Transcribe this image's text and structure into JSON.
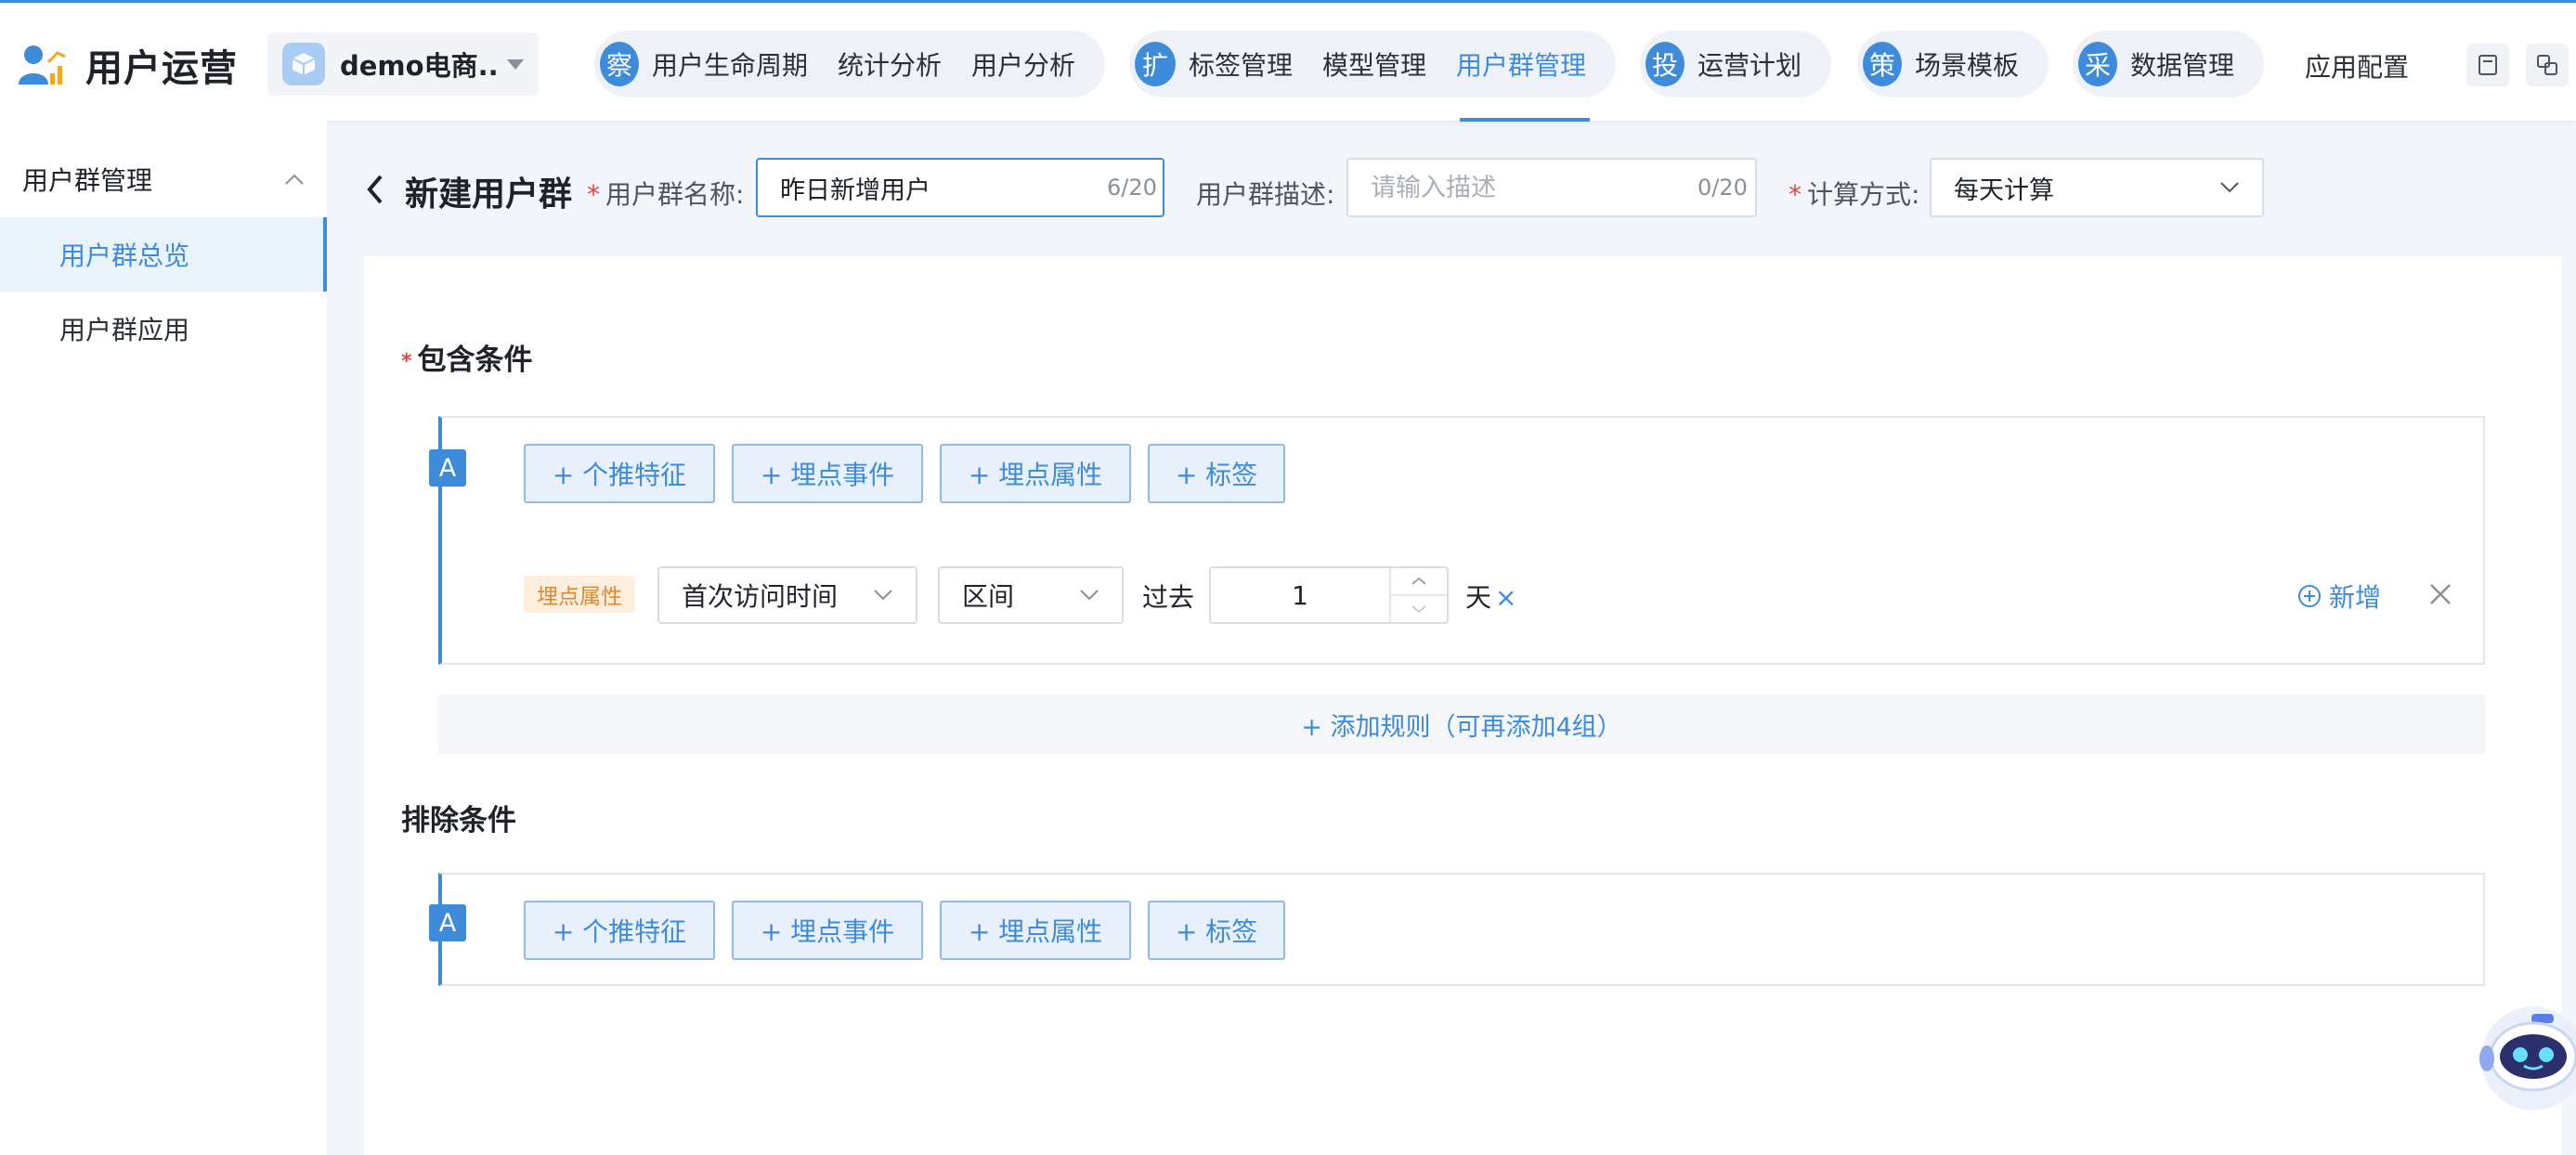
{
  "app": {
    "title": "用户运营"
  },
  "project": {
    "name": "demo电商..."
  },
  "nav": {
    "group1": {
      "badge": "察",
      "items": [
        "用户生命周期",
        "统计分析",
        "用户分析"
      ]
    },
    "group2": {
      "badge": "扩",
      "items": [
        "标签管理",
        "模型管理",
        "用户群管理"
      ],
      "active": "用户群管理"
    },
    "group3": {
      "badge": "投",
      "items": [
        "运营计划"
      ]
    },
    "group4": {
      "badge": "策",
      "items": [
        "场景模板"
      ]
    },
    "group5": {
      "badge": "采",
      "items": [
        "数据管理"
      ]
    },
    "plain": "应用配置"
  },
  "sidebar": {
    "group": "用户群管理",
    "items": [
      {
        "label": "用户群总览",
        "active": true
      },
      {
        "label": "用户群应用",
        "active": false
      }
    ]
  },
  "form": {
    "title": "新建用户群",
    "name_label": "用户群名称:",
    "name_value": "昨日新增用户",
    "name_counter": "6/20",
    "desc_label": "用户群描述:",
    "desc_placeholder": "请输入描述",
    "desc_counter": "0/20",
    "calc_label": "计算方式:",
    "calc_value": "每天计算"
  },
  "include": {
    "title": "包含条件",
    "group_tag": "A",
    "buttons": [
      "+ 个推特征",
      "+ 埋点事件",
      "+ 埋点属性",
      "+ 标签"
    ],
    "condition": {
      "tag": "埋点属性",
      "field": "首次访问时间",
      "operator": "区间",
      "prefix": "过去",
      "value": "1",
      "unit": "天",
      "remove_glyph": "×"
    },
    "add_new": "新增",
    "add_rule": "+ 添加规则（可再添加4组）"
  },
  "exclude": {
    "title": "排除条件",
    "group_tag": "A",
    "buttons": [
      "+ 个推特征",
      "+ 埋点事件",
      "+ 埋点属性",
      "+ 标签"
    ]
  },
  "colors": {
    "accent": "#3d8bd9",
    "required": "#e8453c",
    "tag_bg": "#fdeedd",
    "tag_text": "#e0882e"
  }
}
